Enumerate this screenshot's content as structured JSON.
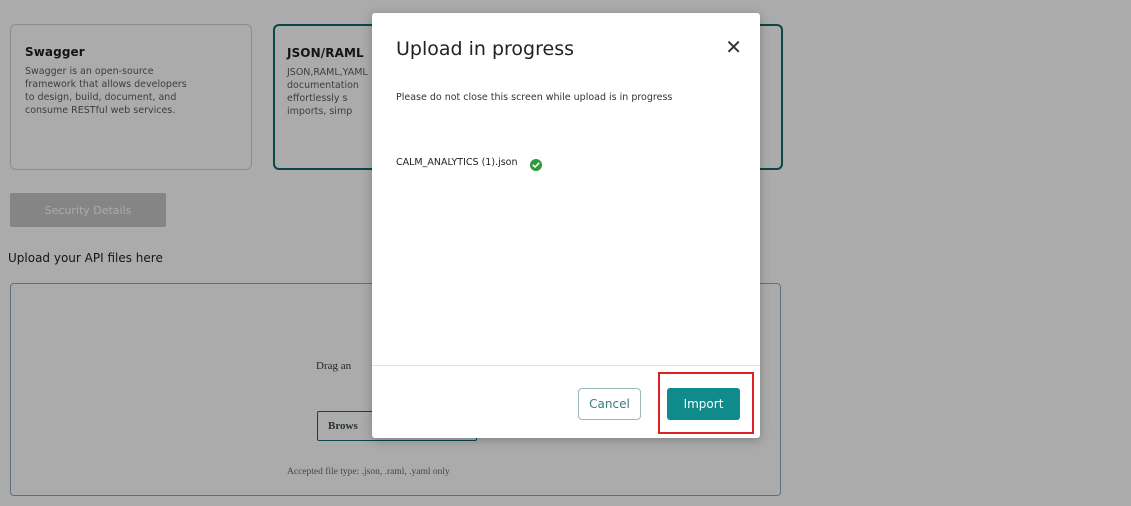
{
  "cards": [
    {
      "title": "Swagger",
      "description": "Swagger is an open-source\nframework that allows developers\nto design, build, document, and\nconsume RESTful web services."
    },
    {
      "title": "JSON/RAML",
      "description": "JSON,RAML,YAML\ndocumentation\neffortlessly s\nimports, simp"
    }
  ],
  "security_button_label": "Security Details",
  "upload_heading": "Upload your API files here",
  "dropzone": {
    "drag_text": "Drag an",
    "browse_label": "Brows",
    "accepted_text": "Accepted file type: .json, .raml, .yaml only"
  },
  "modal": {
    "title": "Upload in progress",
    "close_symbol": "✕",
    "message": "Please do not close this screen while upload is in progress",
    "file_name": "CALM_ANALYTICS (1).json",
    "file_status": "success",
    "cancel_label": "Cancel",
    "import_label": "Import",
    "accent_color": "#0f8b8b",
    "highlight_color": "#e02020"
  }
}
